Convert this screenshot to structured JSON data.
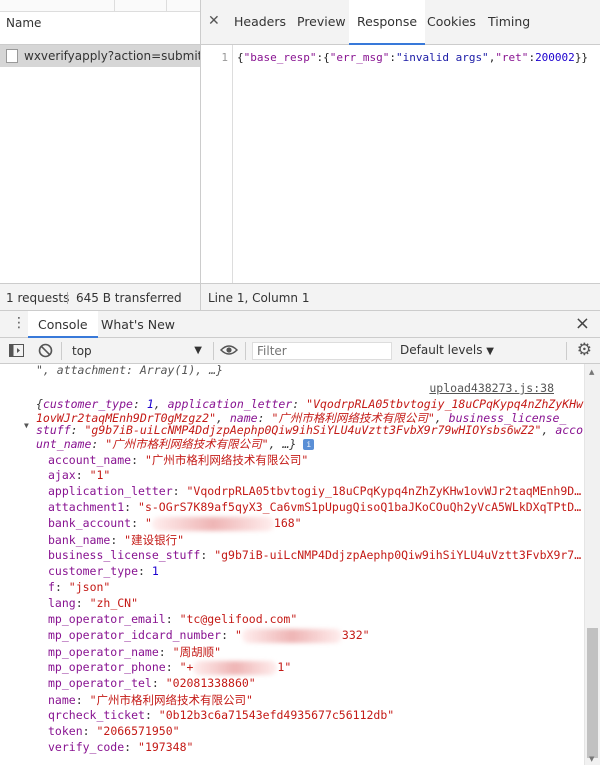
{
  "network": {
    "name_header": "Name",
    "request_name": "wxverifyapply?action=submit...",
    "tabs": [
      "Headers",
      "Preview",
      "Response",
      "Cookies",
      "Timing"
    ],
    "active_tab": "Response",
    "response_line_number": "1",
    "response_parts": {
      "p0": "{",
      "k1": "\"base_resp\"",
      "p1": ":{",
      "k2": "\"err_msg\"",
      "p2": ":",
      "v2": "\"invalid args\"",
      "p3": ",",
      "k3": "\"ret\"",
      "p4": ":",
      "v3": "200002",
      "p5": "}}"
    }
  },
  "status": {
    "requests": "1 requests",
    "transferred": "645 B transferred",
    "cursor": "Line 1, Column 1"
  },
  "drawer": {
    "tabs": [
      "Console",
      "What's New"
    ],
    "active_tab": "Console"
  },
  "toolbar": {
    "context": "top",
    "filter_placeholder": "Filter",
    "levels": "Default levels"
  },
  "console": {
    "prev_line": "\", attachment: Array(1), …}",
    "source_link": "upload438273.js:38",
    "summary": {
      "open": "{",
      "k_customer_type": "customer_type",
      "v_customer_type": "1",
      "k_application_letter": "application_letter",
      "v_application_letter_1": "\"VqodrpRLA05tbvtogiy_18uCPqKypq4nZhZyKHw",
      "v_application_letter_2": "1ovWJr2taqMEnh9DrT0gMzgz2\"",
      "k_name": "name",
      "v_name": "\"广州市格利网络技术有限公司\"",
      "k_business_license_stuff": "business_license_",
      "k_business_license_stuff_2": "stuff",
      "v_business_license_stuff": "\"g9b7iB-uiLcNMP4DdjzpAephp0Qiw9ihSiYLU4uVztt3FvbX9r79wHIOYsbs6wZ2\"",
      "k_account_name_1": "acco",
      "k_account_name_2": "unt_name",
      "v_account_name": "\"广州市格利网络技术有限公司\"",
      "close": "…}"
    },
    "props": [
      {
        "key": "account_name",
        "value": "\"广州市格利网络技术有限公司\"",
        "type": "str"
      },
      {
        "key": "ajax",
        "value": "\"1\"",
        "type": "str"
      },
      {
        "key": "application_letter",
        "value": "\"VqodrpRLA05tbvtogiy_18uCPqKypq4nZhZyKHw1ovWJr2taqMEnh9D…",
        "type": "str"
      },
      {
        "key": "attachment1",
        "value": "\"s-OGrS7K89af5qyX3_Ca6vmS1pUpugQisoQ1baJKoCOuQh2yVcA5WLkDXqTPtD…",
        "type": "str"
      },
      {
        "key": "bank_account",
        "value_prefix": "\"",
        "value": "168\"",
        "type": "redacted",
        "redact_width": 122
      },
      {
        "key": "bank_name",
        "value": "\"建设银行\"",
        "type": "str"
      },
      {
        "key": "business_license_stuff",
        "value": "\"g9b7iB-uiLcNMP4DdjzpAephp0Qiw9ihSiYLU4uVztt3FvbX9r7…",
        "type": "str"
      },
      {
        "key": "customer_type",
        "value": "1",
        "type": "num"
      },
      {
        "key": "f",
        "value": "\"json\"",
        "type": "str"
      },
      {
        "key": "lang",
        "value": "\"zh_CN\"",
        "type": "str"
      },
      {
        "key": "mp_operator_email",
        "value": "\"tc@gelifood.com\"",
        "type": "str"
      },
      {
        "key": "mp_operator_idcard_number",
        "value_prefix": "\"",
        "value": "332\"",
        "type": "redacted",
        "redact_width": 100
      },
      {
        "key": "mp_operator_name",
        "value": "\"周胡顺\"",
        "type": "str"
      },
      {
        "key": "mp_operator_phone",
        "value_prefix": "\"+",
        "value": "1\"",
        "type": "redacted",
        "redact_width": 84
      },
      {
        "key": "mp_operator_tel",
        "value": "\"02081338860\"",
        "type": "str"
      },
      {
        "key": "name",
        "value": "\"广州市格利网络技术有限公司\"",
        "type": "str"
      },
      {
        "key": "qrcheck_ticket",
        "value": "\"0b12b3c6a71543efd4935677c56112db\"",
        "type": "str"
      },
      {
        "key": "token",
        "value": "\"2066571950\"",
        "type": "str"
      },
      {
        "key": "verify_code",
        "value": "\"197348\"",
        "type": "str"
      }
    ]
  }
}
